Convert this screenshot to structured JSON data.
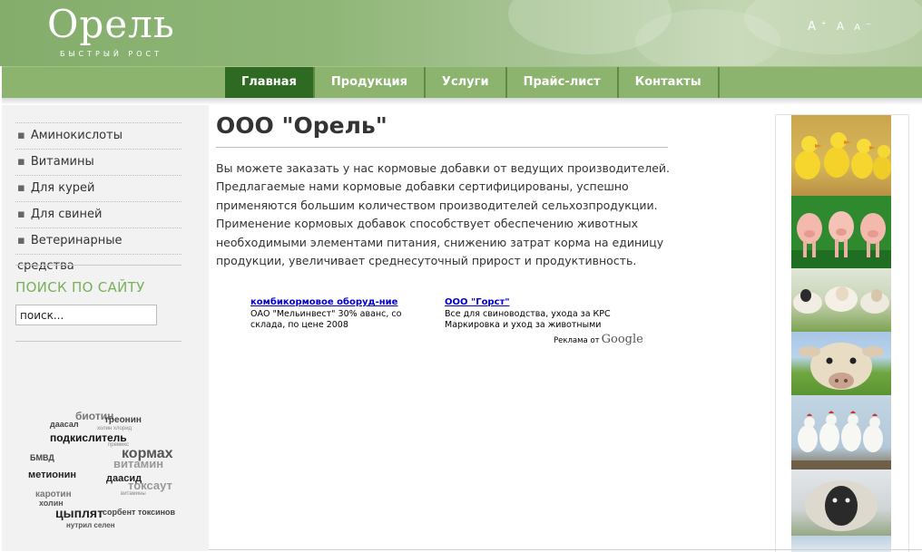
{
  "header": {
    "logo_text": "Орель",
    "logo_tagline": "БЫСТРЫЙ РОСТ",
    "font_controls": [
      "A",
      "A",
      "A"
    ]
  },
  "nav": {
    "items": [
      "Главная",
      "Продукция",
      "Услуги",
      "Прайс-лист",
      "Контакты"
    ],
    "active_index": 0
  },
  "sidebar": {
    "menu": [
      "Аминокислоты",
      "Витамины",
      "Для курей",
      "Для свиней",
      "Ветеринарные средства"
    ],
    "search_title": "ПОИСК ПО САЙТУ",
    "search_value": "поиск..."
  },
  "tag_cloud": [
    "биотин",
    "треонин",
    "даасал",
    "холин хлорид",
    "подкислитель",
    "кормах",
    "БМВД",
    "витамин",
    "метионин",
    "даасид",
    "токсаут",
    "каротин",
    "холин",
    "цыплят",
    "сорбент токсинов",
    "нутрил селен",
    "витамины",
    "премикс"
  ],
  "main": {
    "title": "ООО \"Орель\"",
    "intro": "Вы можете заказать у нас кормовые добавки от ведущих производителей. Предлагаемые нами кормовые добавки сертифицированы, успешно применяются большим количеством производителей сельхозпродукции. Применение кормовых добавок способствует обеспечению животных необходимыми элементами питания, снижению затрат корма на единицу продукции, увеличивает среднесуточный прирост и продуктивность."
  },
  "ads": [
    {
      "title": "комбикормовое оборуд-ние",
      "text": "ОАО \"Мельинвест\" 30% аванс, со склада, по цене 2008"
    },
    {
      "title": "ООО \"Горст\"",
      "text": "Все для свиноводства, ухода за КРС Маркировка и уход за животными"
    }
  ],
  "ad_label": {
    "prefix": "Реклама от",
    "brand": "Google"
  },
  "photos": [
    "ducklings",
    "piglets",
    "sheep",
    "cow",
    "chickens",
    "ram"
  ],
  "colors": {
    "nav_bg": "#8cb46f",
    "nav_active": "#2f6a22",
    "search_title": "#79b05a",
    "ad_link": "#0000cc"
  }
}
